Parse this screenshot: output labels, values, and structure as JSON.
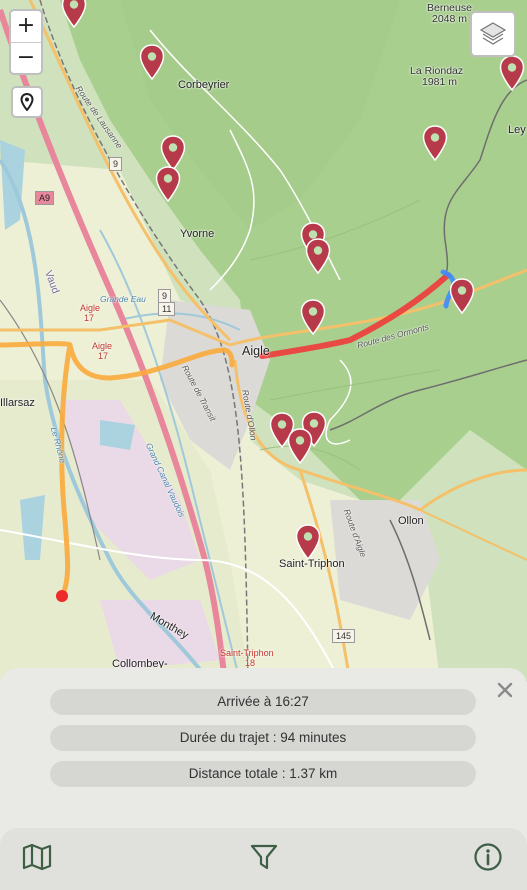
{
  "map": {
    "controls": {
      "zoom_in": "+",
      "zoom_out": "−",
      "locate_icon": "location-pin-icon",
      "layers_icon": "layers-icon"
    },
    "labels": {
      "corbeyrier": "Corbeyrier",
      "yvorne": "Yvorne",
      "aigle": "Aigle",
      "ollon": "Ollon",
      "saint_triphon": "Saint-Triphon",
      "illarsaz": "Illarsaz",
      "collombey": "Collombey-",
      "monthey": "Monthey",
      "berneuse": "Berneuse",
      "berneuse_alt": "2048 m",
      "riondaz": "La Riondaz",
      "riondaz_alt": "1981 m",
      "leysin": "Ley",
      "vaud": "Vaud",
      "grande_eau": "Grande Eau",
      "route_lausanne": "Route de Lausanne",
      "route_ormonts": "Route des Ormonts",
      "route_transit": "Route de Transit",
      "route_ollon": "Route d'Ollon",
      "route_aigle": "Route d'Aigle",
      "grand_canal": "Grand Canal Vaudois",
      "le_rhone": "Le Rhône",
      "aigle_17a": "Aigle",
      "aigle_17a_num": "17",
      "aigle_17b": "Aigle",
      "aigle_17b_num": "17",
      "saint_triphon_18": "Saint-Triphon",
      "saint_triphon_18_num": "18",
      "shield_9a": "9",
      "shield_a9": "A9",
      "shield_9b": "9",
      "shield_11": "11",
      "shield_145": "145"
    }
  },
  "trip": {
    "arrival": "Arrivée à 16:27",
    "duration": "Durée du trajet : 94 minutes",
    "distance": "Distance totale : 1.37 km",
    "close_icon": "close-icon"
  },
  "nav": {
    "map_icon": "map-icon",
    "filter_icon": "filter-icon",
    "info_icon": "info-icon"
  },
  "colors": {
    "marker": "#b73a4a",
    "route_red": "#ee3b3b",
    "route_orange": "#f9aa3c",
    "route_blue": "#3d8bff",
    "nav_icon": "#3f5e46"
  }
}
